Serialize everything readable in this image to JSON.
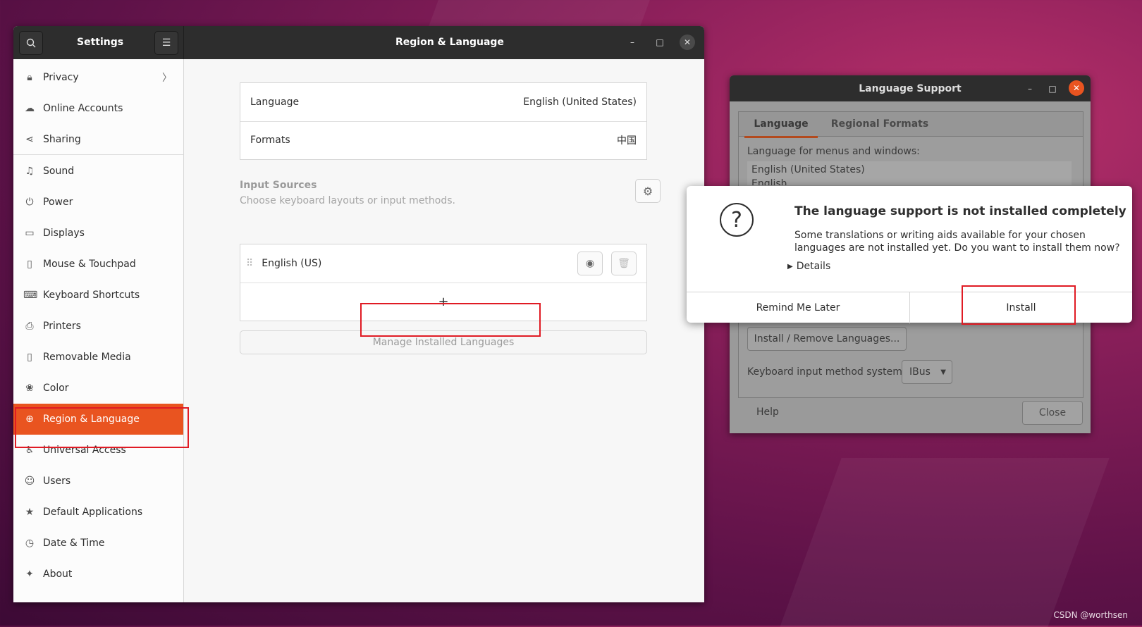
{
  "settings": {
    "app_title": "Settings",
    "panel_title": "Region & Language",
    "sidebar": {
      "items": [
        {
          "label": "Privacy",
          "icon": "lock-icon",
          "glyph": "🔒︎"
        },
        {
          "label": "Online Accounts",
          "icon": "cloud-icon",
          "glyph": "☁"
        },
        {
          "label": "Sharing",
          "icon": "share-icon",
          "glyph": "⋖"
        },
        {
          "label": "Sound",
          "icon": "music-note-icon",
          "glyph": "♫"
        },
        {
          "label": "Power",
          "icon": "power-icon",
          "glyph": "⏻"
        },
        {
          "label": "Displays",
          "icon": "display-icon",
          "glyph": "▭"
        },
        {
          "label": "Mouse & Touchpad",
          "icon": "mouse-icon",
          "glyph": "▯"
        },
        {
          "label": "Keyboard Shortcuts",
          "icon": "keyboard-icon",
          "glyph": "⌨"
        },
        {
          "label": "Printers",
          "icon": "printer-icon",
          "glyph": "⎙"
        },
        {
          "label": "Removable Media",
          "icon": "removable-media-icon",
          "glyph": "▯"
        },
        {
          "label": "Color",
          "icon": "color-icon",
          "glyph": "❀"
        },
        {
          "label": "Region & Language",
          "icon": "globe-icon",
          "glyph": "⊕"
        },
        {
          "label": "Universal Access",
          "icon": "accessibility-icon",
          "glyph": "♿︎"
        },
        {
          "label": "Users",
          "icon": "users-icon",
          "glyph": "☺"
        },
        {
          "label": "Default Applications",
          "icon": "star-icon",
          "glyph": "★"
        },
        {
          "label": "Date & Time",
          "icon": "clock-icon",
          "glyph": "◷"
        },
        {
          "label": "About",
          "icon": "about-icon",
          "glyph": "✦"
        }
      ]
    },
    "language_row": {
      "label": "Language",
      "value": "English (United States)"
    },
    "formats_row": {
      "label": "Formats",
      "value": "中国"
    },
    "input_sources": {
      "title": "Input Sources",
      "subtitle": "Choose keyboard layouts or input methods.",
      "items": [
        {
          "label": "English (US)"
        }
      ],
      "add_label": "+"
    },
    "manage_button": "Manage Installed Languages"
  },
  "language_support": {
    "title": "Language Support",
    "tabs": [
      "Language",
      "Regional Formats"
    ],
    "menus_label": "Language for menus and windows:",
    "language_list": [
      "English (United States)",
      "English"
    ],
    "install_remove_button": "Install / Remove Languages...",
    "input_method_label": "Keyboard input method system:",
    "input_method_value": "IBus",
    "help_button": "Help",
    "close_button": "Close"
  },
  "dialog": {
    "title": "The language support is not installed completely",
    "message_line1": "Some translations or writing aids available for your chosen",
    "message_line2": "languages are not installed yet. Do you want to install them now?",
    "details_label": "Details",
    "remind_button": "Remind Me Later",
    "install_button": "Install"
  },
  "watermark": "CSDN @worthsen",
  "colors": {
    "accent": "#e95420",
    "highlight": "#e01b24"
  }
}
